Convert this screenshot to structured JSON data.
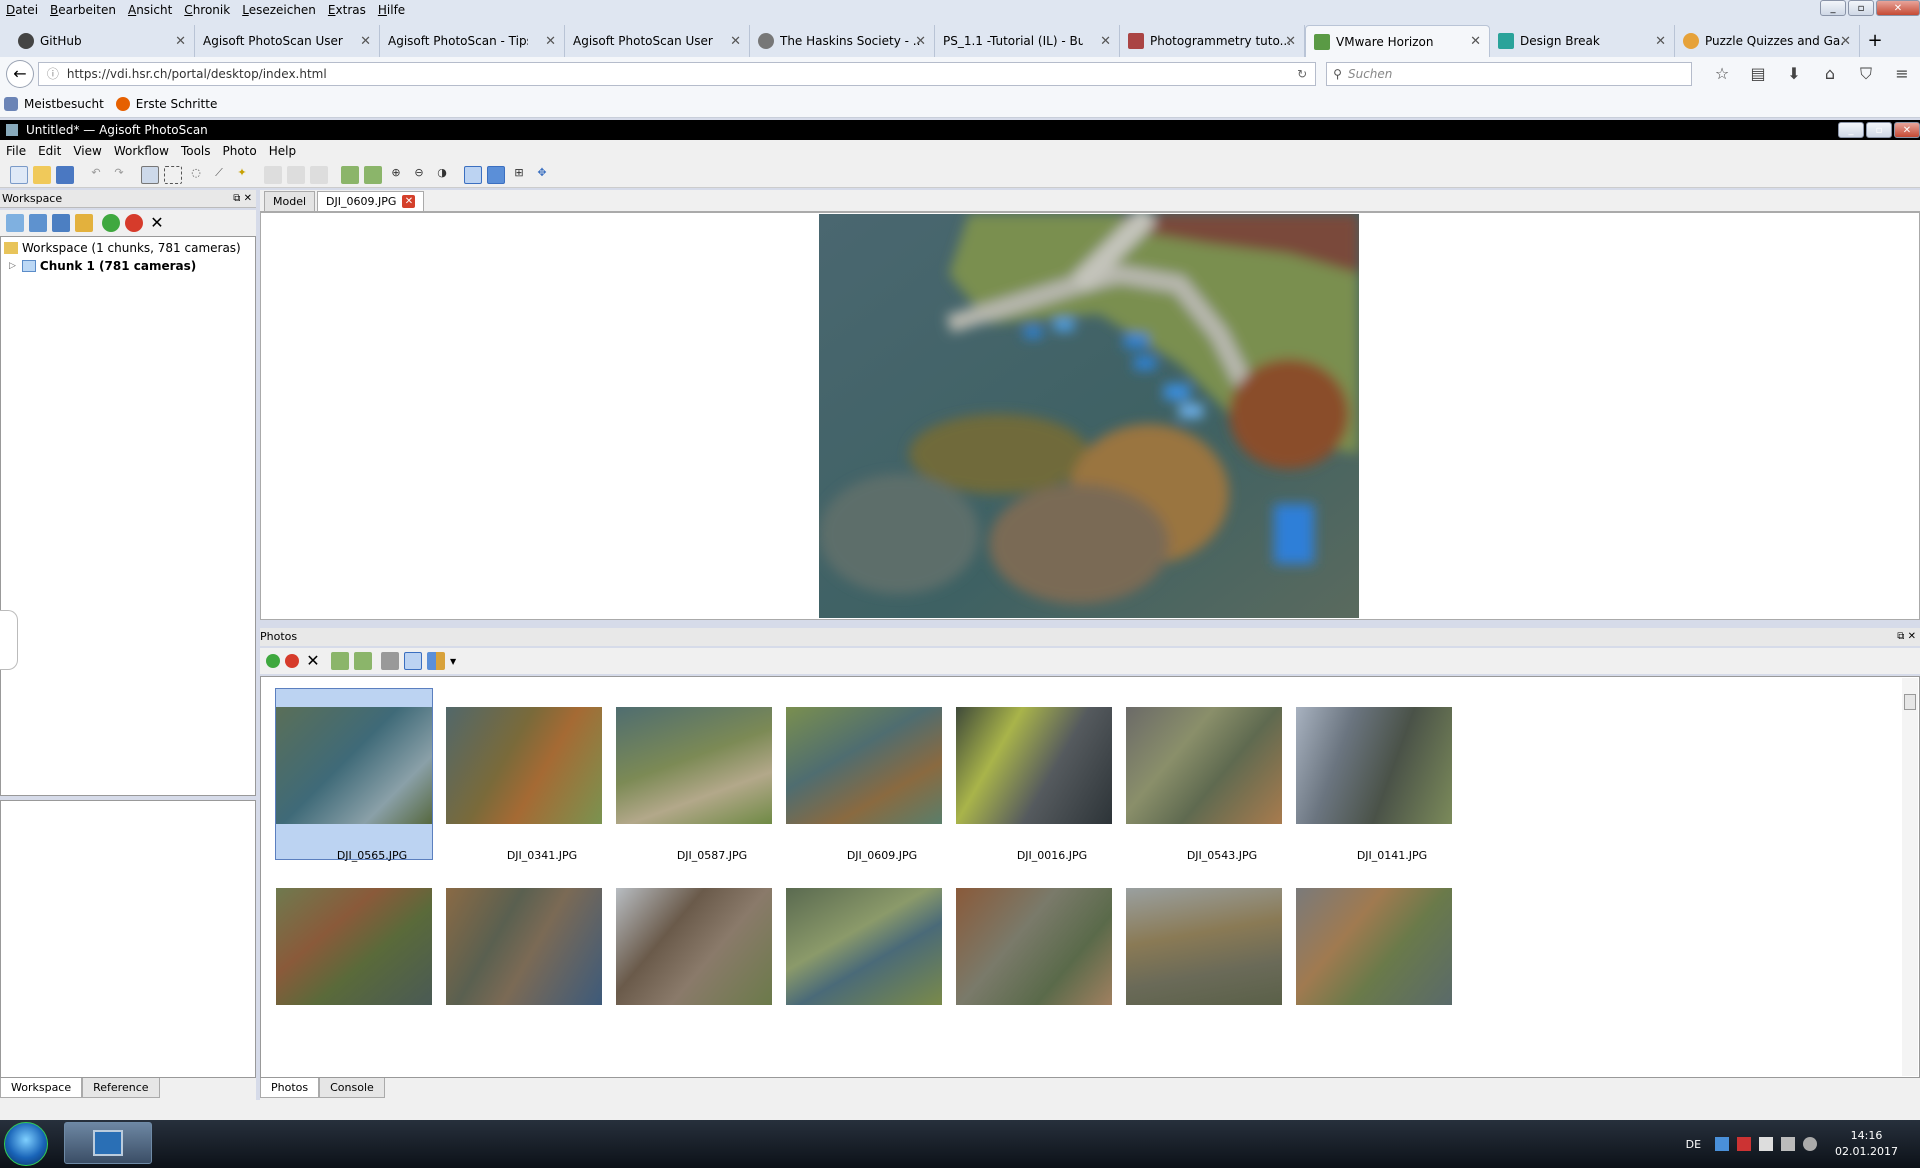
{
  "browser": {
    "menu": [
      "Datei",
      "Bearbeiten",
      "Ansicht",
      "Chronik",
      "Lesezeichen",
      "Extras",
      "Hilfe"
    ],
    "tabs": [
      {
        "label": "GitHub",
        "active": false
      },
      {
        "label": "Agisoft PhotoScan User M...",
        "active": false
      },
      {
        "label": "Agisoft PhotoScan - Tips a...",
        "active": false
      },
      {
        "label": "Agisoft PhotoScan User M...",
        "active": false
      },
      {
        "label": "The Haskins Society - ...",
        "active": false
      },
      {
        "label": "PS_1.1 -Tutorial (IL) - Build...",
        "active": false
      },
      {
        "label": "Photogrammetry tuto...",
        "active": false
      },
      {
        "label": "VMware Horizon",
        "active": true
      },
      {
        "label": "Design Break",
        "active": false
      },
      {
        "label": "Puzzle Quizzes and Ga...",
        "active": false
      }
    ],
    "new_tab": "+",
    "url": "https://vdi.hsr.ch/portal/desktop/index.html",
    "search_placeholder": "Suchen",
    "bookmarks": [
      "Meistbesucht",
      "Erste Schritte"
    ]
  },
  "app": {
    "title": "Untitled* — Agisoft PhotoScan",
    "menu": [
      "File",
      "Edit",
      "View",
      "Workflow",
      "Tools",
      "Photo",
      "Help"
    ]
  },
  "workspace": {
    "header": "Workspace",
    "root": "Workspace (1 chunks, 781 cameras)",
    "chunk": "Chunk 1 (781 cameras)",
    "tabs": [
      "Workspace",
      "Reference"
    ]
  },
  "document_tabs": [
    "Model",
    "DJI_0609.JPG"
  ],
  "photos": {
    "header": "Photos",
    "row1": [
      "DJI_0565.JPG",
      "DJI_0341.JPG",
      "DJI_0587.JPG",
      "DJI_0609.JPG",
      "DJI_0016.JPG",
      "DJI_0543.JPG",
      "DJI_0141.JPG"
    ],
    "selected_index": 0,
    "bottom_tabs": [
      "Photos",
      "Console"
    ]
  },
  "taskbar": {
    "lang": "DE",
    "time": "14:16",
    "date": "02.01.2017"
  }
}
